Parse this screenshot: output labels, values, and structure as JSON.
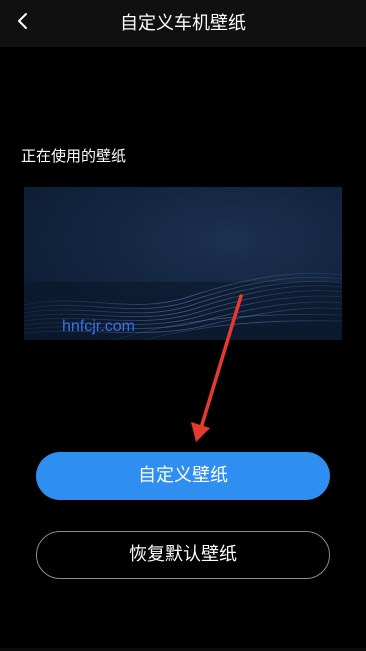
{
  "header": {
    "title": "自定义车机壁纸",
    "back_icon": "chevron-left-icon"
  },
  "section": {
    "label": "正在使用的壁纸"
  },
  "preview": {
    "watermark": "hnfcjr.com",
    "watermark_color": "#3d6fe6"
  },
  "buttons": {
    "custom_label": "自定义壁纸",
    "restore_label": "恢复默认壁纸"
  },
  "colors": {
    "accent": "#2e8ff0",
    "annotation_arrow": "#e53b2e"
  }
}
